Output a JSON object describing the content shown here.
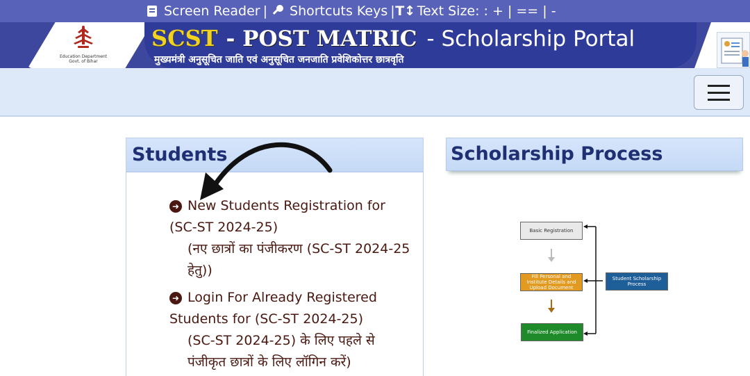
{
  "topbar": {
    "screen_reader": "Screen Reader",
    "shortcuts": "Shortcuts Keys",
    "text_size": "Text Size: : + | == | -"
  },
  "header": {
    "logo_text_line1": "Education Department",
    "logo_text_line2": "Govt. of Bihar",
    "title_scst": "SCST",
    "title_post": "- POST MATRIC",
    "title_portal": "- Scholarship Portal",
    "subtitle": "मुख्यमंत्री अनुसूचित जाति एवं अनुसूचित जनजाति प्रवेशिकोत्तर छात्रवृति"
  },
  "students": {
    "heading": "Students",
    "links": [
      {
        "en": "New Students Registration for (SC-ST 2024-25)",
        "hi": "(नए छात्रों का पंजीकरण (SC-ST 2024-25 हेतु))"
      },
      {
        "en": "Login For Already Registered Students for (SC-ST 2024-25)",
        "hi": "(SC-ST 2024-25) के लिए पहले से पंजीकृत छात्रों के लिए लॉगिन करें)"
      }
    ]
  },
  "process": {
    "heading": "Scholarship Process",
    "boxes": {
      "basic": "Basic Registration",
      "fill": "Fill Personal and Institute Details and Upload Document",
      "final": "Finalized Application",
      "student": "Student Scholarship Process"
    }
  },
  "colors": {
    "banner": "#3d479d",
    "title_accent": "#f2d21e",
    "link": "#4a1810",
    "panel_head": "#c5d9f6"
  },
  "icons": [
    "screen-reader-icon",
    "key-icon",
    "text-size-icon",
    "hamburger-icon",
    "circle-arrow-right-icon",
    "curved-arrow-annotation"
  ]
}
